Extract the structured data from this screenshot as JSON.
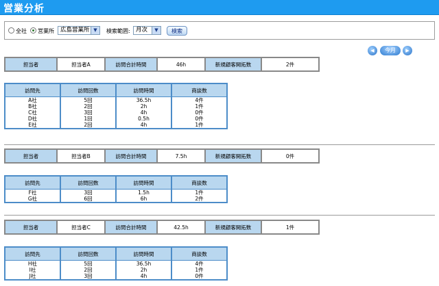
{
  "app": {
    "title": "営業分析"
  },
  "filter": {
    "radio_all": "全社",
    "radio_office": "営業所",
    "office_value": "広島営業所",
    "range_label": "検索範囲:",
    "range_value": "月次",
    "search_label": "検索"
  },
  "nav": {
    "prev_icon": "◀",
    "current_label": "今月",
    "next_icon": "▶"
  },
  "summary_headers": {
    "person": "担当者",
    "total_time": "訪問合計時間",
    "new_clients": "新規顧客開拓数"
  },
  "detail_headers": [
    "訪問先",
    "訪問回数",
    "訪問時間",
    "商談数"
  ],
  "groups": [
    {
      "person": "担当者A",
      "total_time": "46h",
      "new_clients": "2件",
      "rows": [
        [
          "A社",
          "5回",
          "36.5h",
          "4件"
        ],
        [
          "B社",
          "2回",
          "2h",
          "1件"
        ],
        [
          "C社",
          "3回",
          "4h",
          "0件"
        ],
        [
          "D社",
          "1回",
          "0.5h",
          "0件"
        ],
        [
          "E社",
          "2回",
          "4h",
          "1件"
        ]
      ]
    },
    {
      "person": "担当者B",
      "total_time": "7.5h",
      "new_clients": "0件",
      "rows": [
        [
          "F社",
          "3回",
          "1.5h",
          "1件"
        ],
        [
          "G社",
          "6回",
          "6h",
          "2件"
        ]
      ]
    },
    {
      "person": "担当者C",
      "total_time": "42.5h",
      "new_clients": "1件",
      "rows": [
        [
          "H社",
          "5回",
          "36.5h",
          "4件"
        ],
        [
          "I社",
          "2回",
          "2h",
          "1件"
        ],
        [
          "J社",
          "3回",
          "4h",
          "0件"
        ]
      ]
    }
  ]
}
